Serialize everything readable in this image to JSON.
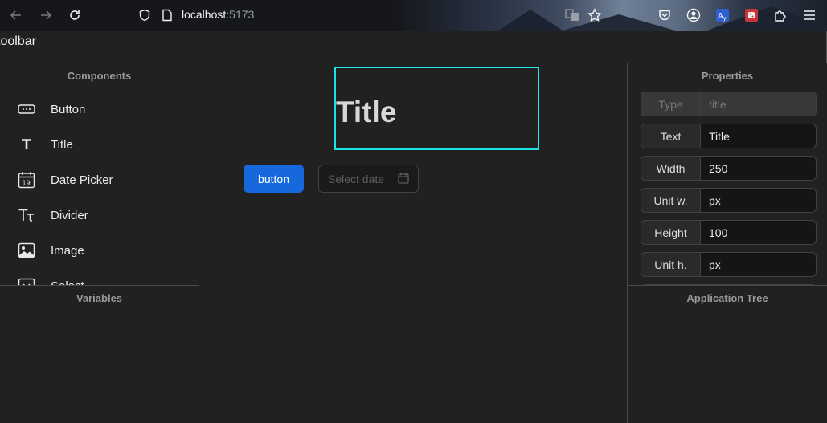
{
  "browser": {
    "url_host": "localhost",
    "url_port": ":5173"
  },
  "toolbar": {
    "label": "toolbar"
  },
  "components": {
    "title": "Components",
    "items": [
      {
        "label": "Button",
        "icon": "button-icon"
      },
      {
        "label": "Title",
        "icon": "text-icon"
      },
      {
        "label": "Date Picker",
        "icon": "calendar-icon",
        "icon_text": "19"
      },
      {
        "label": "Divider",
        "icon": "typography-icon"
      },
      {
        "label": "Image",
        "icon": "image-icon"
      },
      {
        "label": "Select",
        "icon": "select-icon"
      }
    ]
  },
  "variables": {
    "title": "Variables"
  },
  "canvas": {
    "title_text": "Title",
    "button_label": "button",
    "date_placeholder": "Select date",
    "selection_color": "#1fe3e3",
    "button_color": "#1668dc"
  },
  "properties": {
    "title": "Properties",
    "rows": [
      {
        "key": "Type",
        "value": "title"
      },
      {
        "key": "Text",
        "value": "Title"
      },
      {
        "key": "Width",
        "value": "250"
      },
      {
        "key": "Unit w.",
        "value": "px"
      },
      {
        "key": "Height",
        "value": "100"
      },
      {
        "key": "Unit h.",
        "value": "px"
      }
    ]
  },
  "app_tree": {
    "title": "Application Tree"
  }
}
